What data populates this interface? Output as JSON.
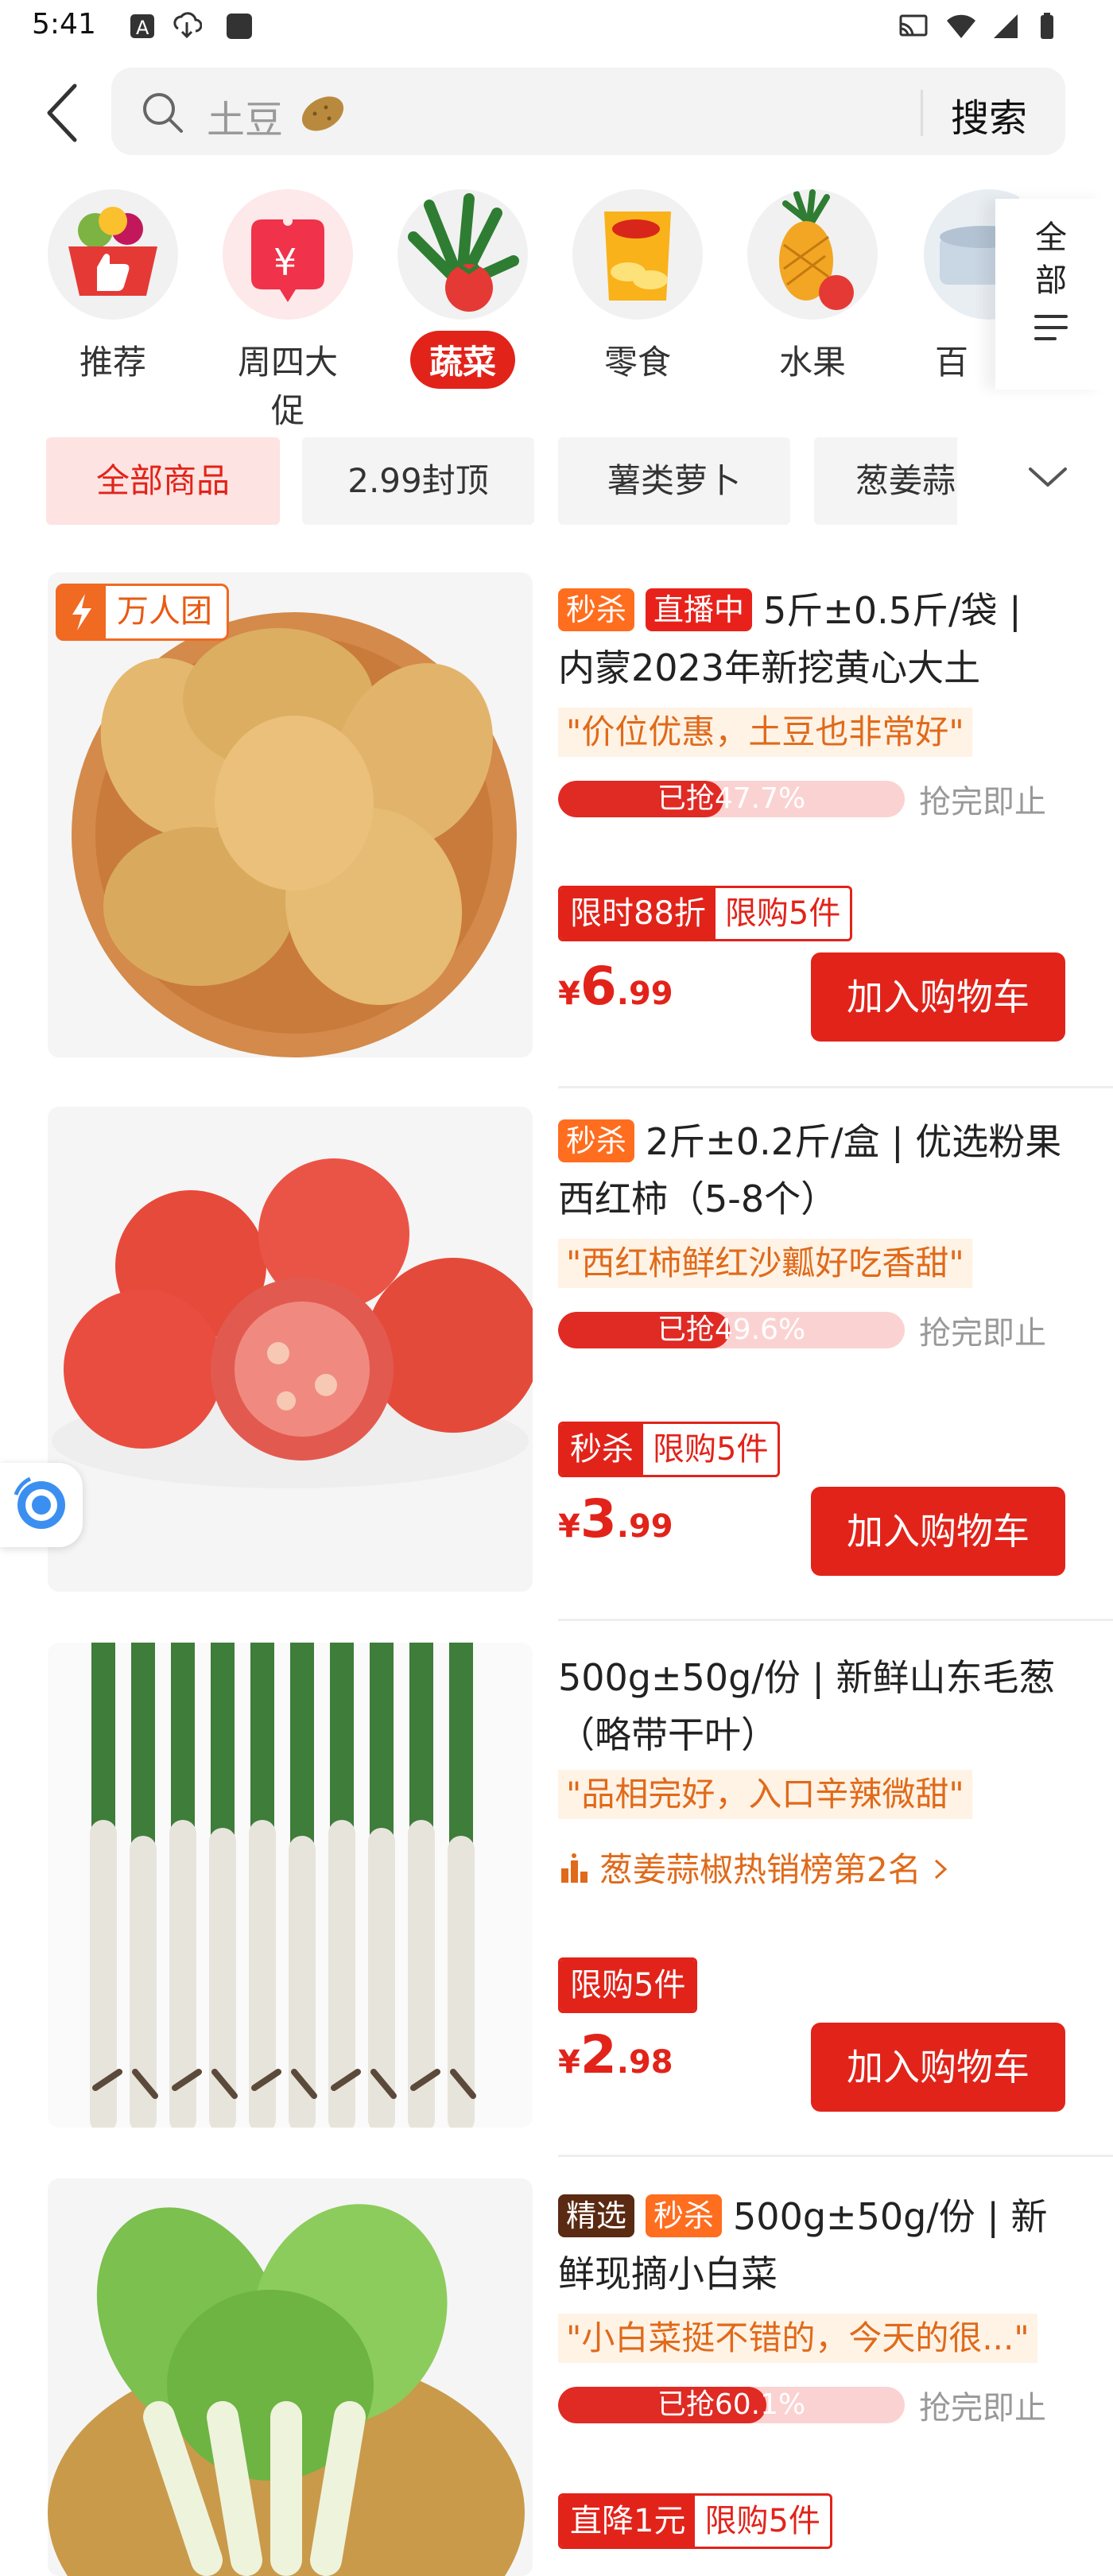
{
  "status_bar": {
    "time": "5:41"
  },
  "search": {
    "placeholder": "土豆",
    "button": "搜索"
  },
  "categories": [
    {
      "label": "推荐"
    },
    {
      "label": "周四大促"
    },
    {
      "label": "蔬菜"
    },
    {
      "label": "零食"
    },
    {
      "label": "水果"
    },
    {
      "label": "百"
    }
  ],
  "all_categories": {
    "line1": "全",
    "line2": "部"
  },
  "filters": [
    {
      "label": "全部商品"
    },
    {
      "label": "2.99封顶"
    },
    {
      "label": "薯类萝卜"
    },
    {
      "label": "葱姜蒜"
    }
  ],
  "products": [
    {
      "badge": "万人团",
      "tags": [
        "秒杀",
        "直播中"
      ],
      "title": "5斤±0.5斤/袋 | 内蒙2023年新挖黄心大土",
      "quote": "\"价位优惠，土豆也非常好\"",
      "progress_text": "已抢47.7%",
      "progress": 0.477,
      "soldout_text": "抢完即止",
      "promo_a": "限时88折",
      "promo_b": "限购5件",
      "price_currency": "¥",
      "price_int": "6",
      "price_dec": ".99",
      "cart": "加入购物车"
    },
    {
      "tags": [
        "秒杀"
      ],
      "title": "2斤±0.2斤/盒 | 优选粉果西红柿（5-8个）",
      "quote": "\"西红柿鲜红沙瓤好吃香甜\"",
      "progress_text": "已抢49.6%",
      "progress": 0.496,
      "soldout_text": "抢完即止",
      "promo_a": "秒杀",
      "promo_b": "限购5件",
      "price_currency": "¥",
      "price_int": "3",
      "price_dec": ".99",
      "cart": "加入购物车"
    },
    {
      "title": "500g±50g/份 | 新鲜山东毛葱（略带干叶）",
      "quote": "\"品相完好，入口辛辣微甜\"",
      "rank": "葱姜蒜椒热销榜第2名",
      "promo_a": "限购5件",
      "price_currency": "¥",
      "price_int": "2",
      "price_dec": ".98",
      "cart": "加入购物车"
    },
    {
      "tags": [
        "精选",
        "秒杀"
      ],
      "title": "500g±50g/份 | 新鲜现摘小白菜",
      "quote": "\"小白菜挺不错的，今天的很...\"",
      "progress_text": "已抢60.1%",
      "progress": 0.601,
      "soldout_text": "抢完即止",
      "promo_a": "直降1元",
      "promo_b": "限购5件"
    }
  ],
  "colors": {
    "accent": "#e2231a",
    "seckill": "#ff6d1f",
    "quote_text": "#e06a1a",
    "quote_bg": "#fff3e6"
  }
}
